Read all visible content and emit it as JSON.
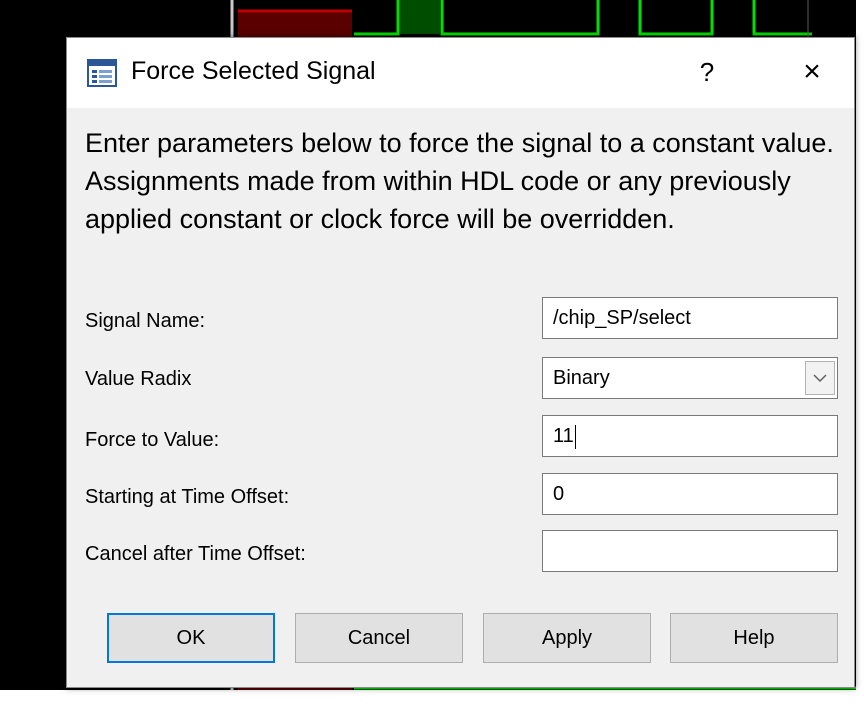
{
  "dialog": {
    "title": "Force Selected Signal",
    "help_glyph": "?",
    "close_glyph": "×",
    "description": "Enter parameters below to force the signal to a constant value. Assignments made from within HDL code or any previously applied constant or clock force will be overridden.",
    "fields": {
      "signal_name": {
        "label": "Signal Name:",
        "value": "/chip_SP/select"
      },
      "value_radix": {
        "label": "Value Radix",
        "value": "Binary"
      },
      "force_value": {
        "label": "Force to Value:",
        "value": "11"
      },
      "start_offset": {
        "label": "Starting at Time Offset:",
        "value": "0"
      },
      "cancel_offset": {
        "label": "Cancel after Time Offset:",
        "value": ""
      }
    },
    "buttons": {
      "ok": "OK",
      "cancel": "Cancel",
      "apply": "Apply",
      "help": "Help"
    }
  },
  "colors": {
    "waveform_green": "#00e000",
    "waveform_dark_green": "#004d00",
    "waveform_red": "#b00000",
    "default_button_border": "#0078d7"
  }
}
